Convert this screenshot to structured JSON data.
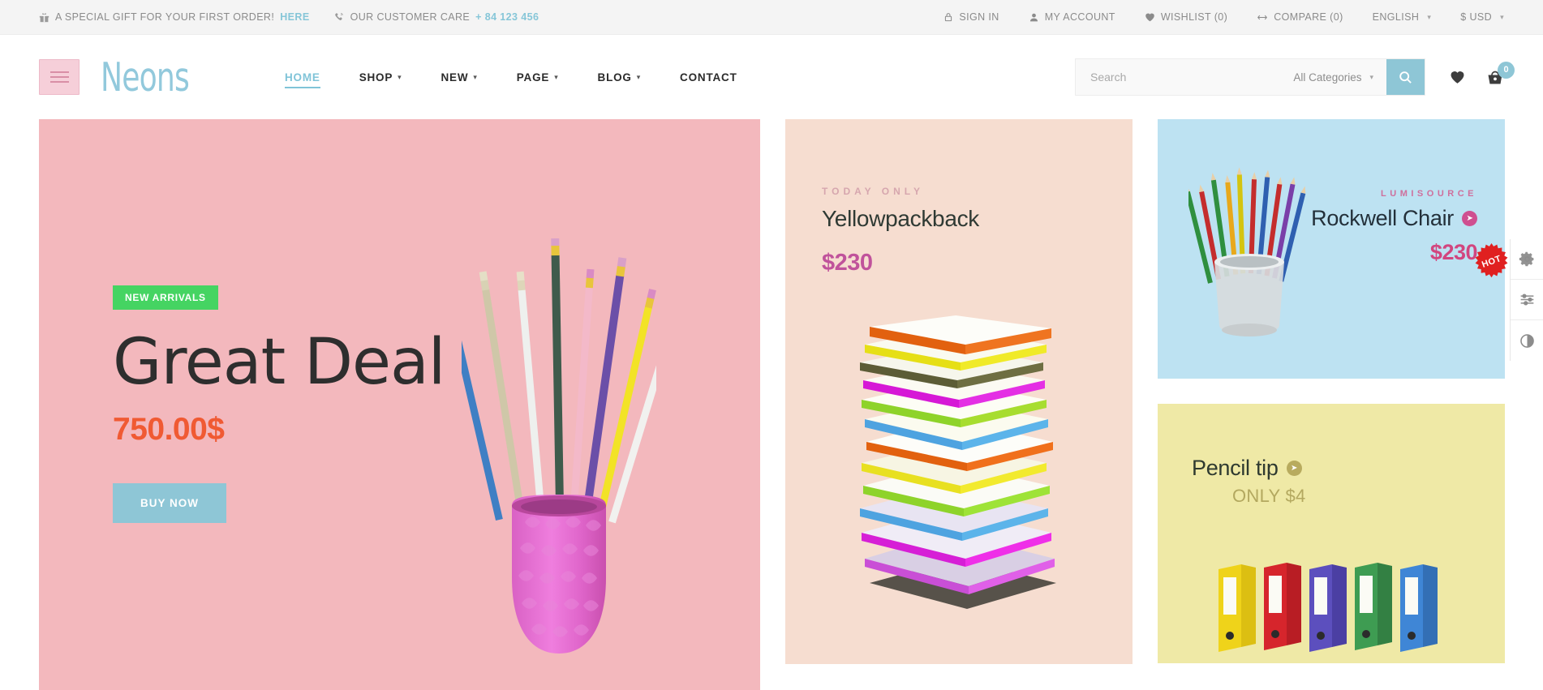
{
  "topbar": {
    "promo": {
      "icon": "gift-icon",
      "text": "A SPECIAL GIFT FOR YOUR FIRST ORDER!",
      "link": "HERE"
    },
    "support": {
      "icon": "phone-icon",
      "text": "OUR CUSTOMER CARE",
      "phone": "+ 84 123 456"
    },
    "right": [
      {
        "name": "sign-in",
        "icon": "lock-icon",
        "label": "SIGN IN"
      },
      {
        "name": "my-account",
        "icon": "user-icon",
        "label": "MY ACCOUNT"
      },
      {
        "name": "wishlist",
        "icon": "heart-icon",
        "label": "WISHLIST (0)"
      },
      {
        "name": "compare",
        "icon": "compare-icon",
        "label": "COMPARE (0)"
      }
    ],
    "language": "ENGLISH",
    "currency": "$ USD"
  },
  "header": {
    "logo": "Neons",
    "menu_button": "menu-toggle",
    "nav": [
      {
        "label": "HOME",
        "active": true,
        "caret": false
      },
      {
        "label": "SHOP",
        "active": false,
        "caret": true
      },
      {
        "label": "NEW",
        "active": false,
        "caret": true
      },
      {
        "label": "PAGE",
        "active": false,
        "caret": true
      },
      {
        "label": "BLOG",
        "active": false,
        "caret": true
      },
      {
        "label": "CONTACT",
        "active": false,
        "caret": false
      }
    ],
    "search": {
      "placeholder": "Search",
      "value": "",
      "category": "All Categories",
      "button_icon": "search-icon"
    },
    "wishlist_icon": "heart-icon",
    "cart_icon": "basket-icon",
    "cart_count": "0"
  },
  "banners": {
    "hero": {
      "badge": "NEW ARRIVALS",
      "title": "Great Deal",
      "price": "750.00$",
      "cta": "BUY NOW",
      "bg": "#f3b8bd",
      "badge_bg": "#45d462",
      "price_color": "#f05a33",
      "cta_bg": "#8ec6d6"
    },
    "center": {
      "eyebrow": "TODAY ONLY",
      "title": "Yellowpackback",
      "price": "$230",
      "bg": "#f6ddd0",
      "eyebrow_color": "#d6a6ae",
      "price_color": "#c0529b"
    },
    "chair": {
      "eyebrow": "LUMISOURCE",
      "title": "Rockwell Chair",
      "price": "$230",
      "bg": "#bde2f2",
      "eyebrow_color": "#cf6f9c",
      "price_color": "#d2467f",
      "arrow_icon": "chevron-right-icon"
    },
    "pencil": {
      "title": "Pencil tip",
      "subtitle": "ONLY $4",
      "bg": "#efe9a6",
      "subtitle_color": "#b3a85f",
      "arrow_icon": "chevron-right-icon"
    }
  },
  "hot_badge": {
    "label": "HOT",
    "color": "#e02020"
  },
  "sidepanel": [
    {
      "name": "settings",
      "icon": "gear-icon"
    },
    {
      "name": "layout-options",
      "icon": "sliders-icon"
    },
    {
      "name": "contrast-mode",
      "icon": "contrast-icon"
    }
  ]
}
